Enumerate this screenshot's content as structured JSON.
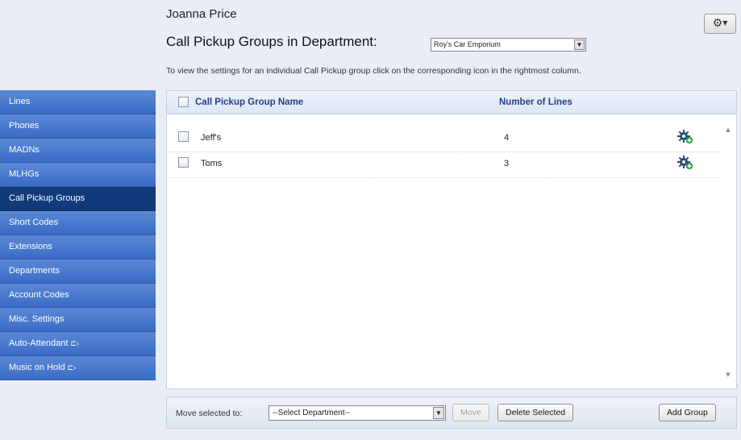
{
  "header": {
    "user_name": "Joanna Price",
    "title": "Call Pickup Groups in Department:",
    "department_selected": "Roy's Car Emporium",
    "instructions": "To view the settings for an individual Call Pickup group click on the corresponding icon in the rightmost column.",
    "gear_menu_icon": "gear-icon"
  },
  "sidebar": {
    "items": [
      {
        "label": "Lines",
        "active": false
      },
      {
        "label": "Phones",
        "active": false
      },
      {
        "label": "MADNs",
        "active": false
      },
      {
        "label": "MLHGs",
        "active": false
      },
      {
        "label": "Call Pickup Groups",
        "active": true
      },
      {
        "label": "Short Codes",
        "active": false
      },
      {
        "label": "Extensions",
        "active": false
      },
      {
        "label": "Departments",
        "active": false
      },
      {
        "label": "Account Codes",
        "active": false
      },
      {
        "label": "Misc. Settings",
        "active": false
      },
      {
        "label": "Auto-Attendant",
        "active": false,
        "external": true
      },
      {
        "label": "Music on Hold",
        "active": false,
        "external": true
      }
    ],
    "external_glyph": "⊏›"
  },
  "table": {
    "columns": {
      "name": "Call Pickup Group Name",
      "lines": "Number of Lines"
    },
    "rows": [
      {
        "name": "Jeff's",
        "lines": "4"
      },
      {
        "name": "Toms",
        "lines": "3"
      }
    ]
  },
  "footer": {
    "move_label": "Move selected to:",
    "move_select_value": "--Select Department--",
    "move_button": "Move",
    "delete_button": "Delete Selected",
    "add_button": "Add Group"
  },
  "colors": {
    "nav_blue": "#3a6bc5",
    "nav_active": "#123a7a",
    "header_text": "#1f3f86",
    "gear_green": "#2f9a3e"
  }
}
